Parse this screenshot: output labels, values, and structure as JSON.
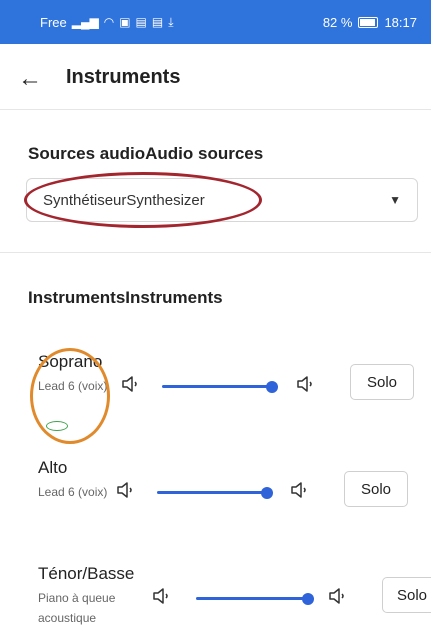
{
  "status_bar": {
    "carrier": "Free",
    "battery": "82 %",
    "time": "18:17"
  },
  "header": {
    "title": "Instruments"
  },
  "audio_sources": {
    "label": "Sources audioAudio sources",
    "selected": "SynthétiseurSynthesizer"
  },
  "instruments": {
    "label": "InstrumentsInstruments",
    "items": [
      {
        "name": "Soprano",
        "description": "Lead 6 (voix)",
        "volume": 0.92,
        "solo_label": "Solo"
      },
      {
        "name": "Alto",
        "description": "Lead 6 (voix)",
        "volume": 0.92,
        "solo_label": "Solo"
      },
      {
        "name": "Ténor/Basse",
        "description": "Piano à queue acoustique",
        "volume": 0.92,
        "solo_label": "Solo"
      }
    ]
  },
  "colors": {
    "status_bar": "#2f73dc",
    "slider": "#2f63d9",
    "annotation_red": "#a3262e",
    "annotation_orange": "#e08a2c",
    "annotation_green": "#3fa34d"
  }
}
